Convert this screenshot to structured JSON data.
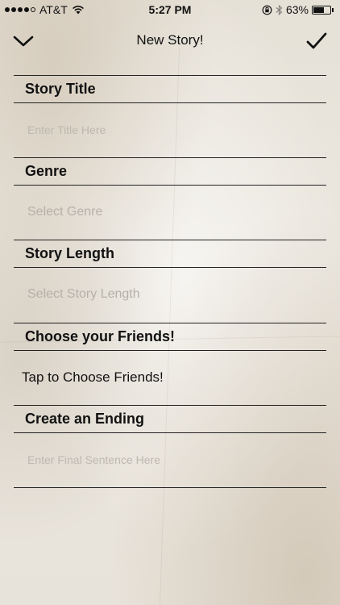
{
  "status_bar": {
    "carrier": "AT&T",
    "time": "5:27 PM",
    "battery_text": "63%",
    "battery_level": 0.63,
    "signal_bars_filled": 4,
    "signal_bars_total": 5
  },
  "nav": {
    "title": "New Story!",
    "back_icon": "chevron-down-icon",
    "done_icon": "checkmark-icon"
  },
  "form": {
    "story_title": {
      "label": "Story Title",
      "placeholder": "Enter Title Here",
      "value": ""
    },
    "genre": {
      "label": "Genre",
      "placeholder": "Select Genre",
      "value": ""
    },
    "story_length": {
      "label": "Story Length",
      "placeholder": "Select Story Length",
      "value": ""
    },
    "friends": {
      "label": "Choose your Friends!",
      "action": "Tap to Choose Friends!"
    },
    "ending": {
      "label": "Create an Ending",
      "placeholder": "Enter Final Sentence Here",
      "value": ""
    }
  },
  "colors": {
    "paper": "#e8e4dc",
    "ink": "#111111",
    "placeholder": "#b5b1aa"
  }
}
